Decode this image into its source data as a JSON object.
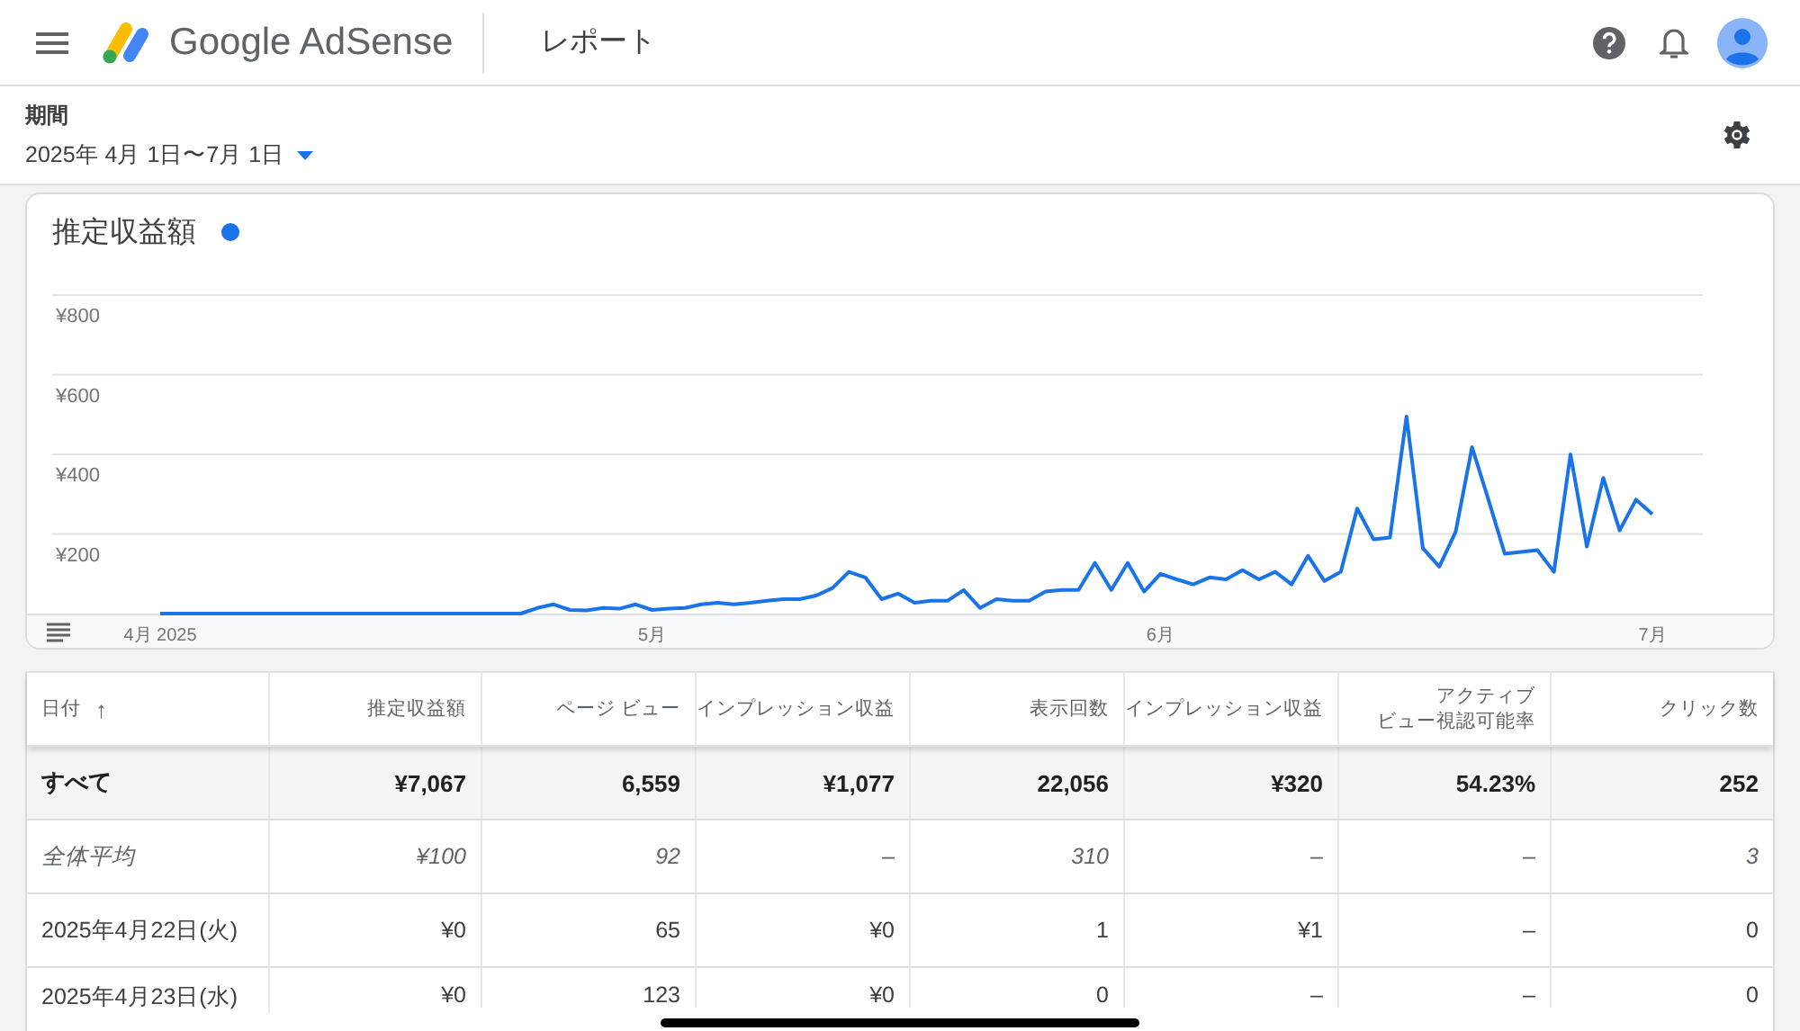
{
  "header": {
    "product": "Google AdSense",
    "page_title": "レポート"
  },
  "period": {
    "label": "期間",
    "value": "2025年 4月 1日〜7月 1日"
  },
  "chart": {
    "chart_data": {
      "type": "line",
      "grid": true,
      "ylim": [
        0,
        800
      ],
      "categories": [
        "4月 2025",
        null,
        null,
        null,
        null,
        null,
        null,
        null,
        null,
        null,
        null,
        null,
        null,
        null,
        null,
        null,
        null,
        null,
        null,
        null,
        null,
        null,
        null,
        null,
        null,
        null,
        null,
        null,
        null,
        null,
        "5月",
        null,
        null,
        null,
        null,
        null,
        null,
        null,
        null,
        null,
        null,
        null,
        null,
        null,
        null,
        null,
        null,
        null,
        null,
        null,
        null,
        null,
        null,
        null,
        null,
        null,
        null,
        null,
        null,
        null,
        null,
        "6月",
        null,
        null,
        null,
        null,
        null,
        null,
        null,
        null,
        null,
        null,
        null,
        null,
        null,
        null,
        null,
        null,
        null,
        null,
        null,
        null,
        null,
        null,
        null,
        null,
        null,
        null,
        null,
        null,
        null,
        "7月"
      ],
      "yticks": [
        {
          "value": 200,
          "label": "¥200"
        },
        {
          "value": 400,
          "label": "¥400"
        },
        {
          "value": 600,
          "label": "¥600"
        },
        {
          "value": 800,
          "label": "¥800"
        }
      ],
      "series": [
        {
          "name": "推定収益額",
          "color": "#1a73e8",
          "values": [
            0,
            0,
            0,
            0,
            0,
            0,
            0,
            0,
            0,
            0,
            0,
            0,
            0,
            0,
            0,
            0,
            0,
            0,
            0,
            0,
            0,
            0,
            0,
            14,
            23,
            9,
            8,
            14,
            12,
            23,
            9,
            12,
            14,
            23,
            27,
            23,
            27,
            32,
            36,
            36,
            45,
            64,
            105,
            91,
            36,
            50,
            27,
            32,
            32,
            59,
            14,
            36,
            32,
            32,
            55,
            59,
            59,
            127,
            59,
            127,
            55,
            100,
            86,
            73,
            91,
            86,
            109,
            86,
            105,
            73,
            145,
            82,
            105,
            264,
            186,
            191,
            495,
            164,
            118,
            205,
            418,
            286,
            150,
            155,
            159,
            105,
            400,
            168,
            341,
            209,
            286,
            250
          ]
        }
      ]
    }
  },
  "table": {
    "columns": [
      {
        "label": "日付",
        "sort_arrow": "↑"
      },
      {
        "label": "推定収益額"
      },
      {
        "label": "ページ ビュー"
      },
      {
        "label": "インプレッション収益"
      },
      {
        "label": "表示回数"
      },
      {
        "label": "インプレッション収益"
      },
      {
        "lines": [
          "アクティブ",
          "ビュー視認可能率"
        ]
      },
      {
        "label": "クリック数"
      }
    ],
    "rows": [
      {
        "kind": "total",
        "cells": [
          "すべて",
          "¥7,067",
          "6,559",
          "¥1,077",
          "22,056",
          "¥320",
          "54.23%",
          "252"
        ]
      },
      {
        "kind": "average",
        "cells": [
          "全体平均",
          "¥100",
          "92",
          "–",
          "310",
          "–",
          "–",
          "3"
        ]
      },
      {
        "kind": "day",
        "cells": [
          "2025年4月22日(火)",
          "¥0",
          "65",
          "¥0",
          "1",
          "¥1",
          "–",
          "0"
        ]
      },
      {
        "kind": "day",
        "cells": [
          "2025年4月23日(水)",
          "¥0",
          "123",
          "¥0",
          "0",
          "–",
          "–",
          "0"
        ]
      }
    ]
  }
}
